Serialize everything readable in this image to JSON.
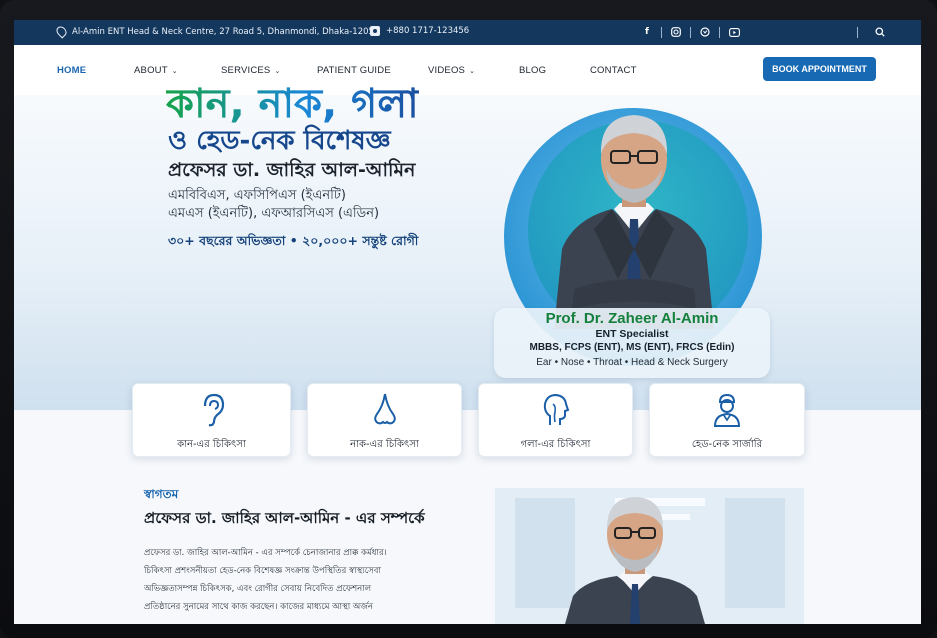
{
  "topbar": {
    "address": "Al-Amin ENT Head & Neck Centre, 27 Road 5, Dhanmondi, Dhaka-1205",
    "phone": "+880 1717-123456",
    "social_icons": [
      "facebook-icon",
      "instagram-icon",
      "whatsapp-icon",
      "youtube-icon"
    ]
  },
  "nav": {
    "items": [
      {
        "label": "HOME",
        "active": true,
        "dropdown": false
      },
      {
        "label": "ABOUT",
        "dropdown": true
      },
      {
        "label": "SERVICES",
        "dropdown": true
      },
      {
        "label": "PATIENT GUIDE",
        "dropdown": false
      },
      {
        "label": "VIDEOS",
        "dropdown": true
      },
      {
        "label": "BLOG",
        "dropdown": false
      },
      {
        "label": "CONTACT",
        "dropdown": false
      }
    ],
    "cta": "BOOK APPOINTMENT"
  },
  "hero": {
    "title": "কান, নাক, গলা",
    "subtitle": "ও হেড-নেক বিশেষজ্ঞ",
    "name": "প্রফেসর ডা. জাহির আল-আমিন",
    "degrees_line1": "এমবিবিএস, এফসিপিএস (ইএনটি)",
    "degrees_line2": "এমএস (ইএনটি), এফআরসিএস (এডিন)",
    "stats": "৩০+ বছরের অভিজ্ঞতা • ২০,০০০+ সন্তুষ্ট রোগী"
  },
  "doctor_card": {
    "name": "Prof. Dr. Zaheer Al-Amin",
    "specialty": "ENT Specialist",
    "degrees": "MBBS, FCPS (ENT), MS (ENT), FRCS (Edin)",
    "areas": "Ear  •  Nose  •  Throat  •  Head & Neck Surgery"
  },
  "services": [
    {
      "label": "কান-এর চিকিৎসা",
      "icon": "ear-icon"
    },
    {
      "label": "নাক-এর চিকিৎসা",
      "icon": "nose-icon"
    },
    {
      "label": "গলা-এর চিকিৎসা",
      "icon": "throat-icon"
    },
    {
      "label": "হেড-নেক সার্জারি",
      "icon": "surgeon-icon"
    }
  ],
  "about": {
    "welcome": "স্বাগতম",
    "title": "প্রফেসর ডা. জাহির আল-আমিন - এর সম্পর্কে",
    "lines": [
      "প্রফেসর ডা. জাহির আল-আমিন - এর সম্পর্কে চেনাজানার প্রাক্ক কর্মধার।",
      "চিকিৎসা প্রশংসনীয়তা হেড-নেক বিশেষজ্ঞ সংক্রান্ত উপস্থিতির স্বাস্থ্যসেবা",
      "অভিজ্ঞতাসম্পন্ন চিকিৎসক, এবং রোগীর সেবায় নিবেদিত প্রফেশনাল",
      "প্রতিষ্ঠানের সুনামের সাথে কাজ করছেন। কাজের মাধ্যমে আস্থা অর্জন"
    ]
  },
  "colors": {
    "topbar": "#14375d",
    "accent": "#1769b3",
    "green": "#14803c"
  }
}
